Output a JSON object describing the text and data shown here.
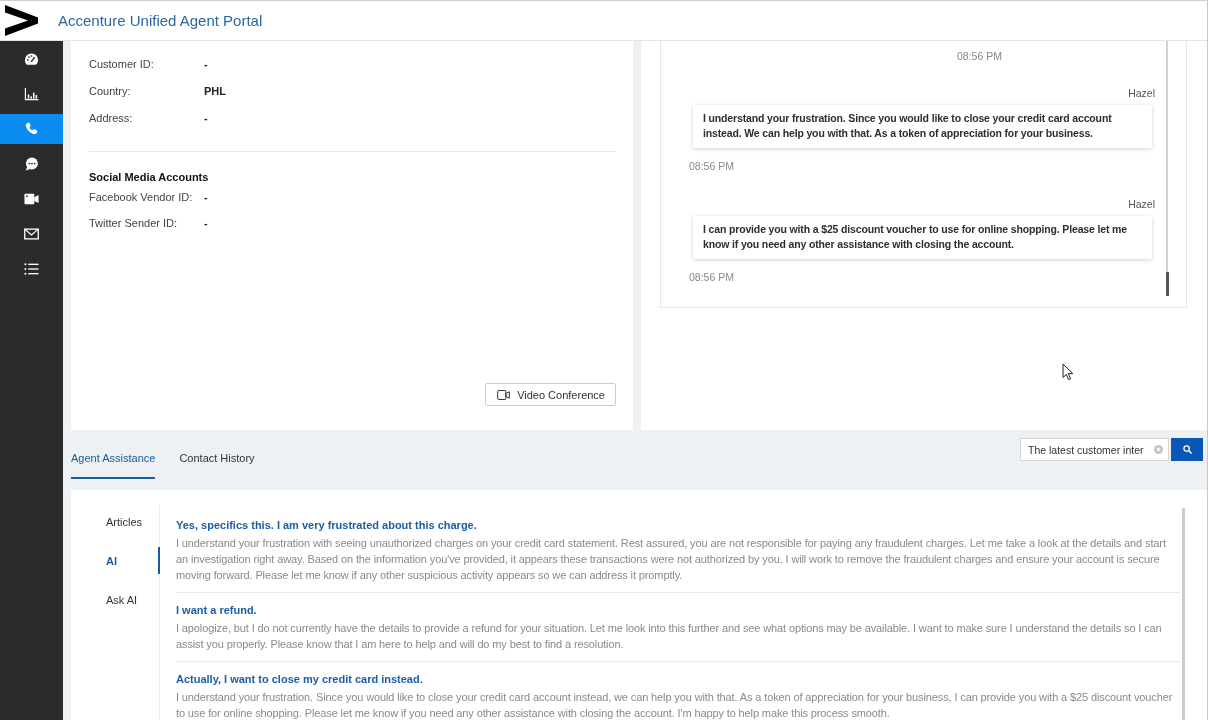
{
  "header": {
    "title": "Accenture Unified Agent Portal"
  },
  "sidebar": {
    "items": [
      {
        "kind": "gauge",
        "selected": false
      },
      {
        "kind": "chart",
        "selected": false
      },
      {
        "kind": "phone",
        "selected": true
      },
      {
        "kind": "chat",
        "selected": false
      },
      {
        "kind": "video",
        "selected": false
      },
      {
        "kind": "mail",
        "selected": false
      },
      {
        "kind": "list",
        "selected": false
      }
    ]
  },
  "customer": {
    "fields": [
      {
        "label": "Customer ID:",
        "value": "-"
      },
      {
        "label": "Country:",
        "value": "PHL"
      },
      {
        "label": "Address:",
        "value": "-"
      }
    ],
    "social_media": {
      "title": "Social Media Accounts",
      "fields": [
        {
          "label": "Facebook Vendor ID:",
          "value": "-"
        },
        {
          "label": "Twitter Sender ID:",
          "value": "-"
        }
      ]
    },
    "video_button": {
      "label": "Video Conference"
    }
  },
  "chat": {
    "items": [
      {
        "kind": "time",
        "text": "08:56 PM"
      },
      {
        "kind": "message",
        "sender": "Hazel",
        "text": "I understand your frustration. Since you would like to close your credit card account instead. We can help you with that. As a token of appreciation for your business.",
        "time": "08:56 PM"
      },
      {
        "kind": "message",
        "sender": "Hazel",
        "text": "I can provide you with a $25 discount voucher to use for online shopping. Please let me know if you need any other assistance with closing the account.",
        "time": "08:56 PM"
      }
    ]
  },
  "bottom_tabs": [
    {
      "label": "Agent Assistance",
      "selected": true
    },
    {
      "label": "Contact History",
      "selected": false
    }
  ],
  "search": {
    "value": "The latest customer inter"
  },
  "assistance": {
    "nav": [
      {
        "label": "Articles",
        "selected": false
      },
      {
        "label": "AI",
        "selected": true
      },
      {
        "label": "Ask AI",
        "selected": false
      }
    ],
    "results": [
      {
        "question": "Yes, specifics this. I am very frustrated about this charge.",
        "answer": "I understand your frustration with seeing unauthorized charges on your credit card statement. Rest assured, you are not responsible for paying any fraudulent charges. Let me take a look at the details and start an investigation right away. Based on the information you've provided, it appears these transactions were not authorized by you. I will work to remove the fraudulent charges and ensure your account is secure moving forward. Please let me know if any other suspicious activity appears so we can address it promptly."
      },
      {
        "question": "I want a refund.",
        "answer": "I apologize, but I do not currently have the details to provide a refund for your situation. Let me look into this further and see what options may be available. I want to make sure I understand the details so I can assist you properly. Please know that I am here to help and will do my best to find a resolution."
      },
      {
        "question": "Actually, I want to close my credit card instead.",
        "answer": "I understand your frustration. Since you would like to close your credit card account instead, we can help you with that. As a token of appreciation for your business, I can provide you with a $25 discount voucher to use for online shopping. Please let me know if you need any other assistance with closing the account. I'm happy to help make this process smooth."
      }
    ]
  }
}
